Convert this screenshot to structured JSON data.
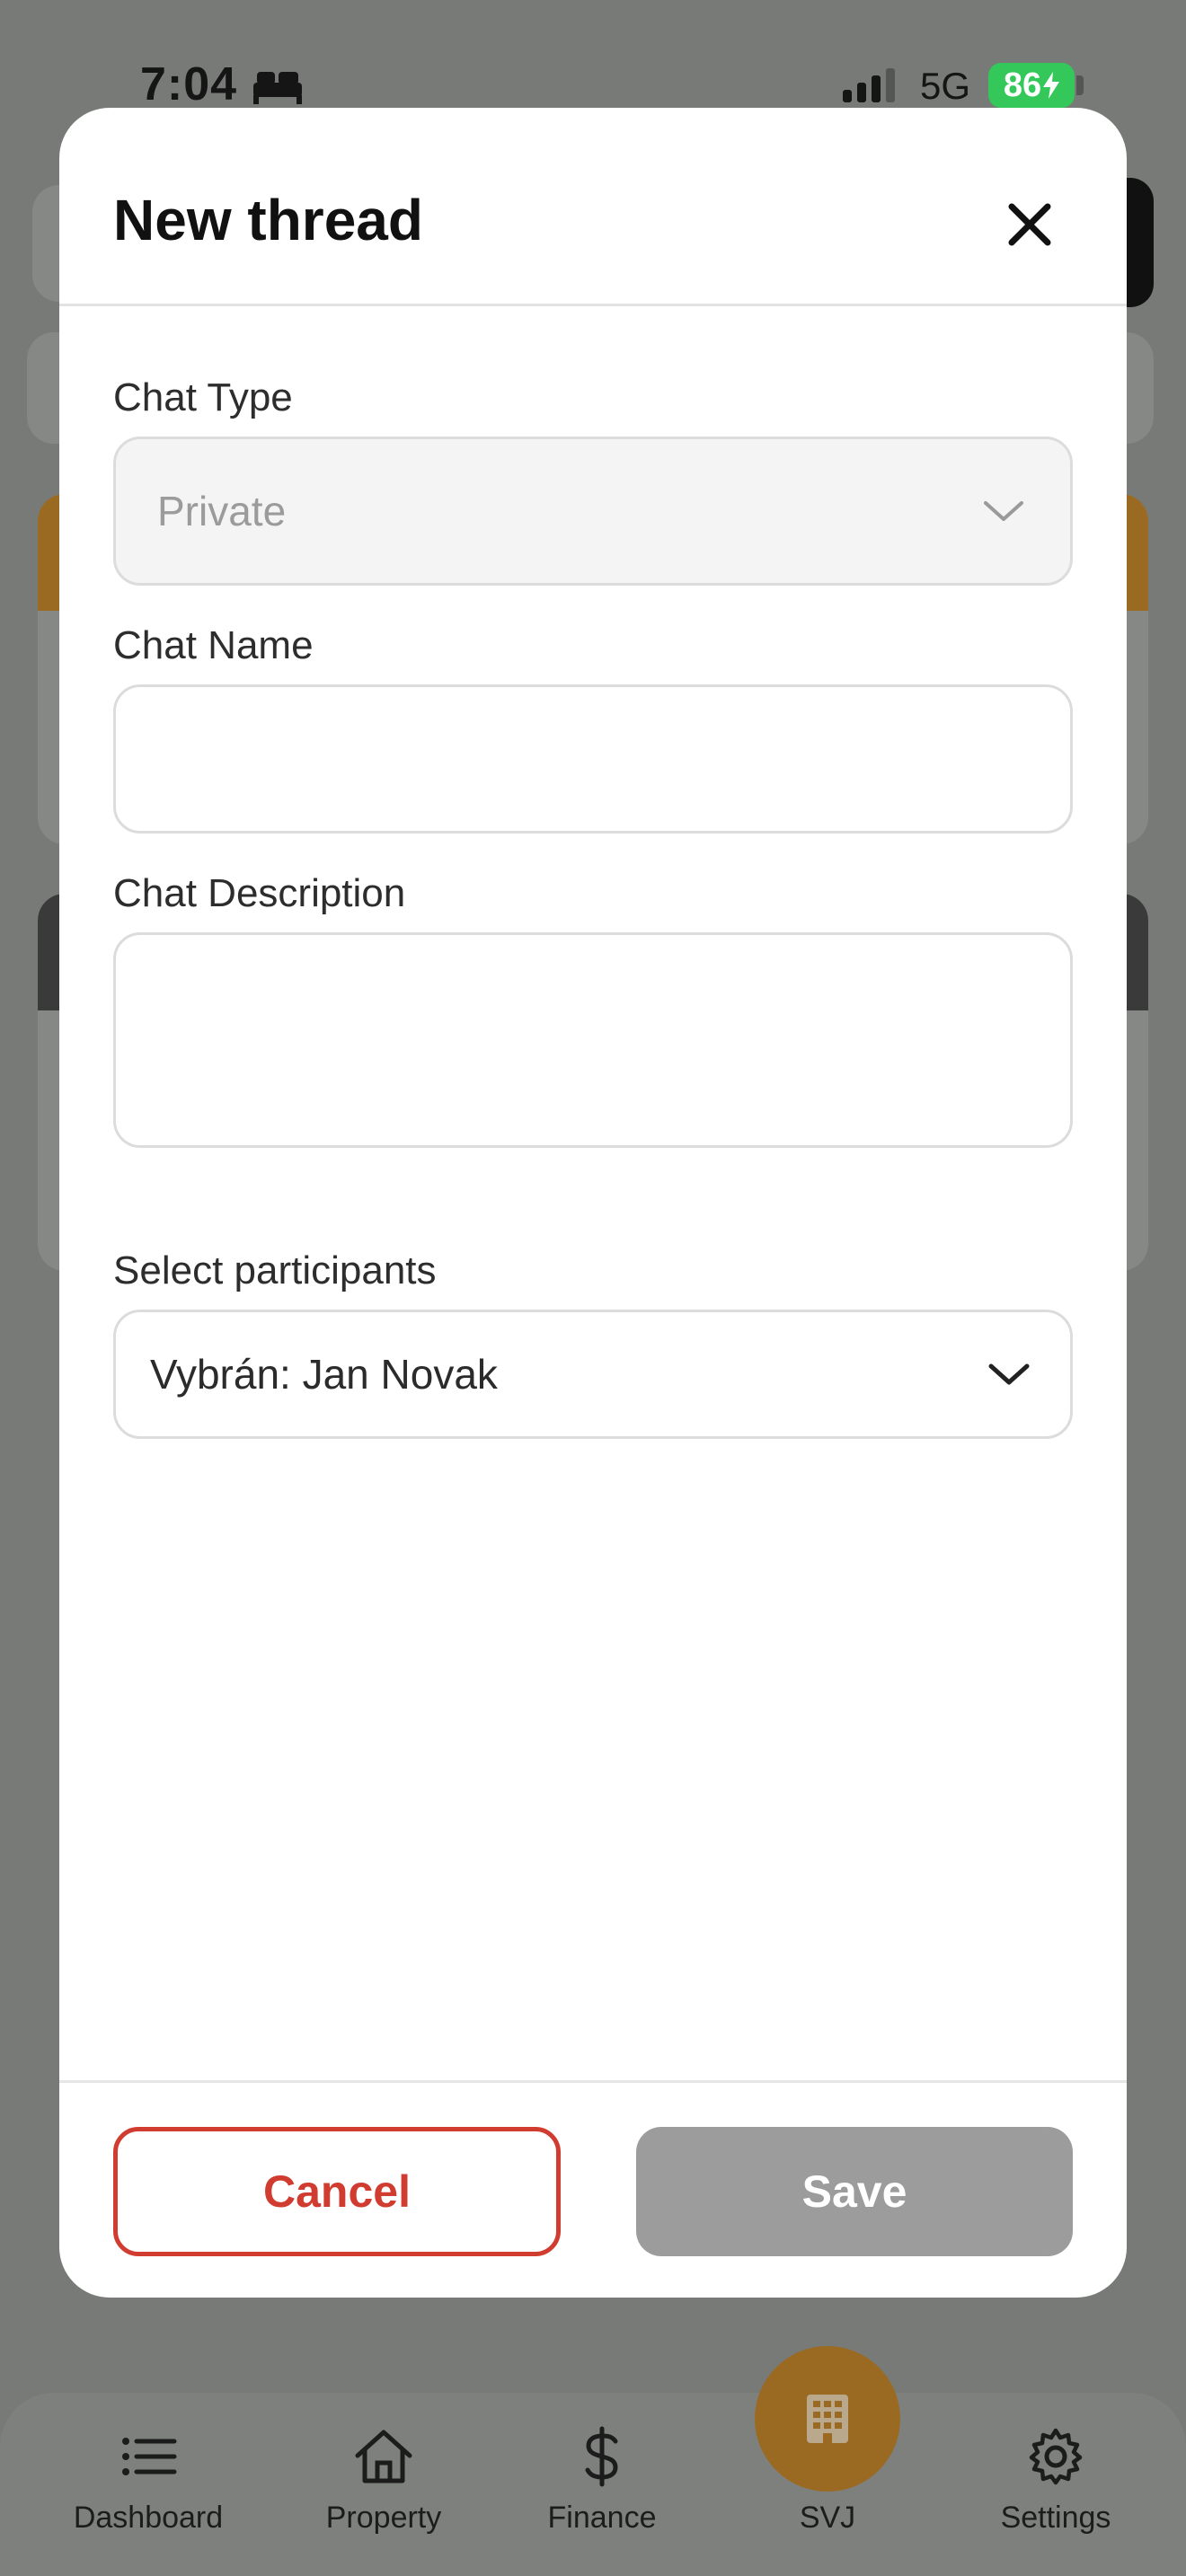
{
  "status_bar": {
    "time": "7:04",
    "network": "5G",
    "battery": "86"
  },
  "modal": {
    "title": "New thread",
    "chat_type": {
      "label": "Chat Type",
      "value": "Private"
    },
    "chat_name": {
      "label": "Chat Name",
      "value": ""
    },
    "chat_description": {
      "label": "Chat Description",
      "value": ""
    },
    "participants": {
      "label": "Select participants",
      "value": "Vybrán: Jan Novak"
    },
    "cancel_label": "Cancel",
    "save_label": "Save"
  },
  "tabbar": {
    "items": [
      {
        "label": "Dashboard",
        "icon": "list-icon"
      },
      {
        "label": "Property",
        "icon": "home-icon"
      },
      {
        "label": "Finance",
        "icon": "dollar-icon"
      },
      {
        "label": "SVJ",
        "icon": "building-icon"
      },
      {
        "label": "Settings",
        "icon": "gear-icon"
      }
    ]
  },
  "colors": {
    "danger": "#d13c30",
    "accent": "#e08a16",
    "disabled": "#9c9c9c",
    "battery": "#34c759"
  }
}
